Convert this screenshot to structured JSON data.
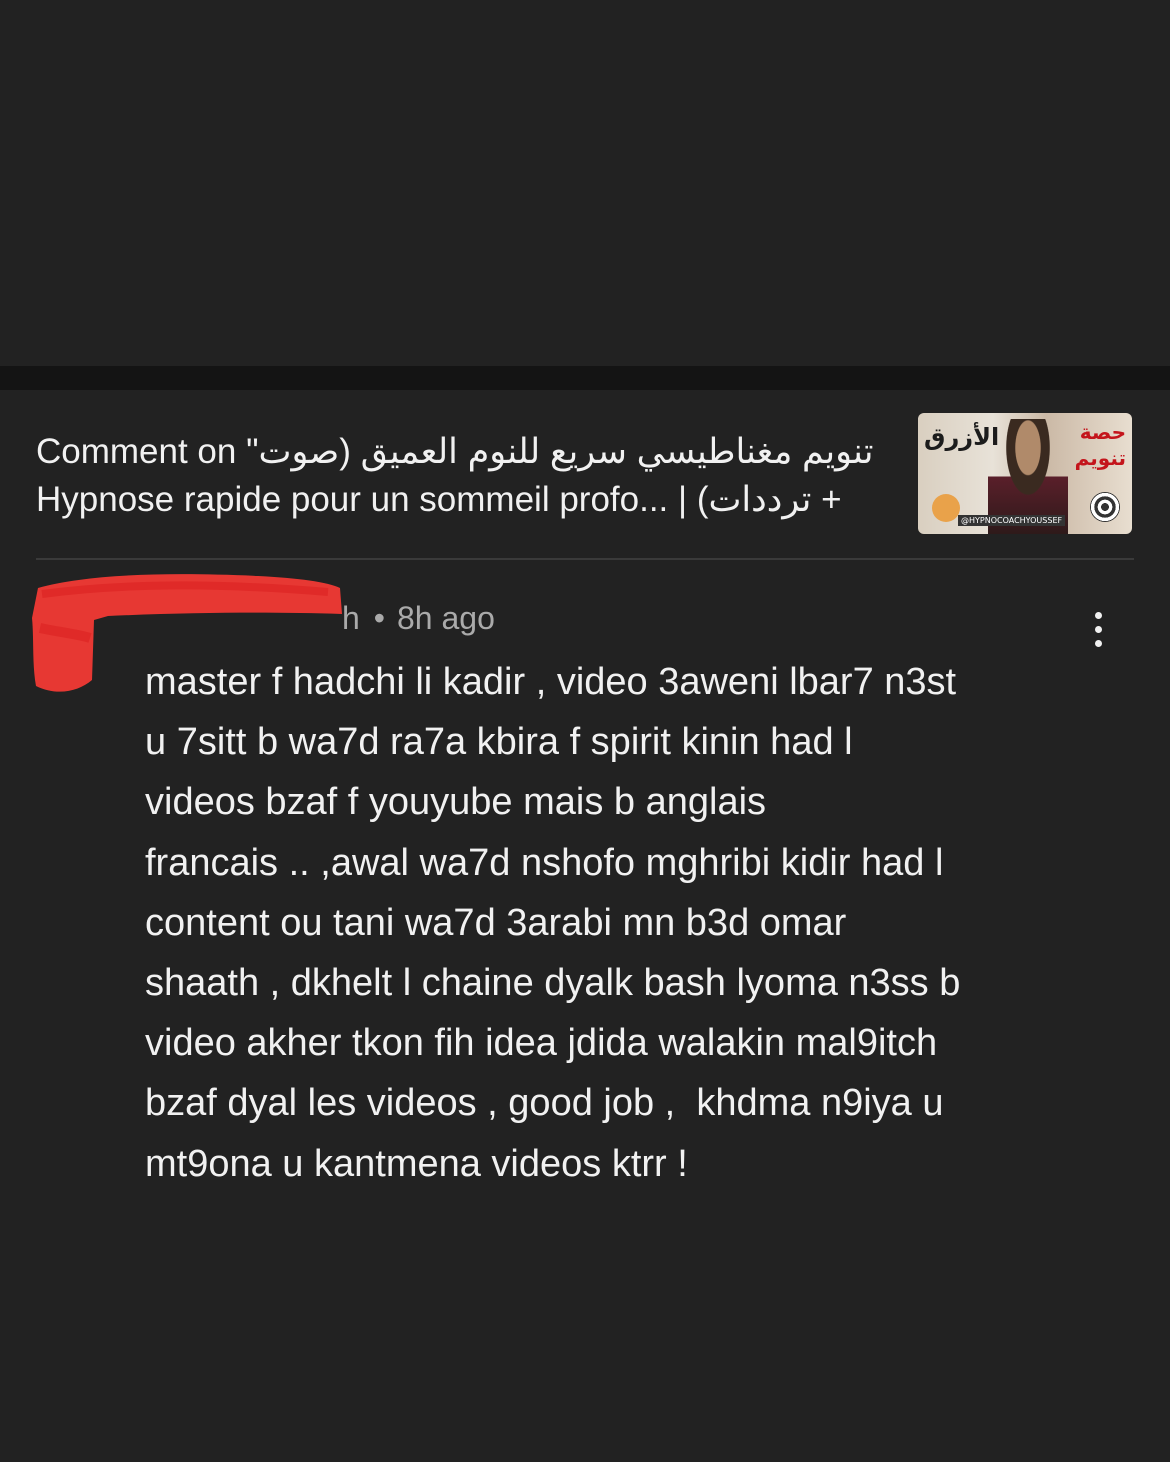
{
  "comment_header": {
    "title_lines": [
      "Comment on \"تنويم مغناطيسي سريع للنوم العميق (صوت",
      "Hypnose rapide pour un sommeil profo... | (ترددات +"
    ],
    "thumbnail": {
      "text_left": "الأزرق",
      "text_right_line1": "حصة",
      "text_right_line2": "تنويم",
      "handle": "@HYPNOCOACHYOUSSEF"
    }
  },
  "comment": {
    "author_visible_fragment": "h",
    "timestamp": "8h ago",
    "body_lines": [
      "master f hadchi li kadir , video 3aweni lbar7 n3st",
      "u 7sitt b wa7d ra7a kbira f spirit kinin had l",
      "videos bzaf f youyube mais b anglais",
      "francais .. ,awal wa7d nshofo mghribi kidir had l",
      "content ou tani wa7d 3arabi mn b3d omar",
      "shaath , dkhelt l chaine dyalk bash lyoma n3ss b",
      "video akher tkon fih idea jdida walakin mal9itch",
      "bzaf dyal les videos , good job ,  khdma n9iya u",
      "mt9ona u kantmena videos ktrr !"
    ]
  },
  "icons": {
    "more": "more-vertical-icon"
  },
  "colors": {
    "background": "#222222",
    "divider_band": "#141414",
    "text_primary": "#f1f1f1",
    "text_secondary": "#aaaaaa",
    "redaction": "#f23a35"
  }
}
